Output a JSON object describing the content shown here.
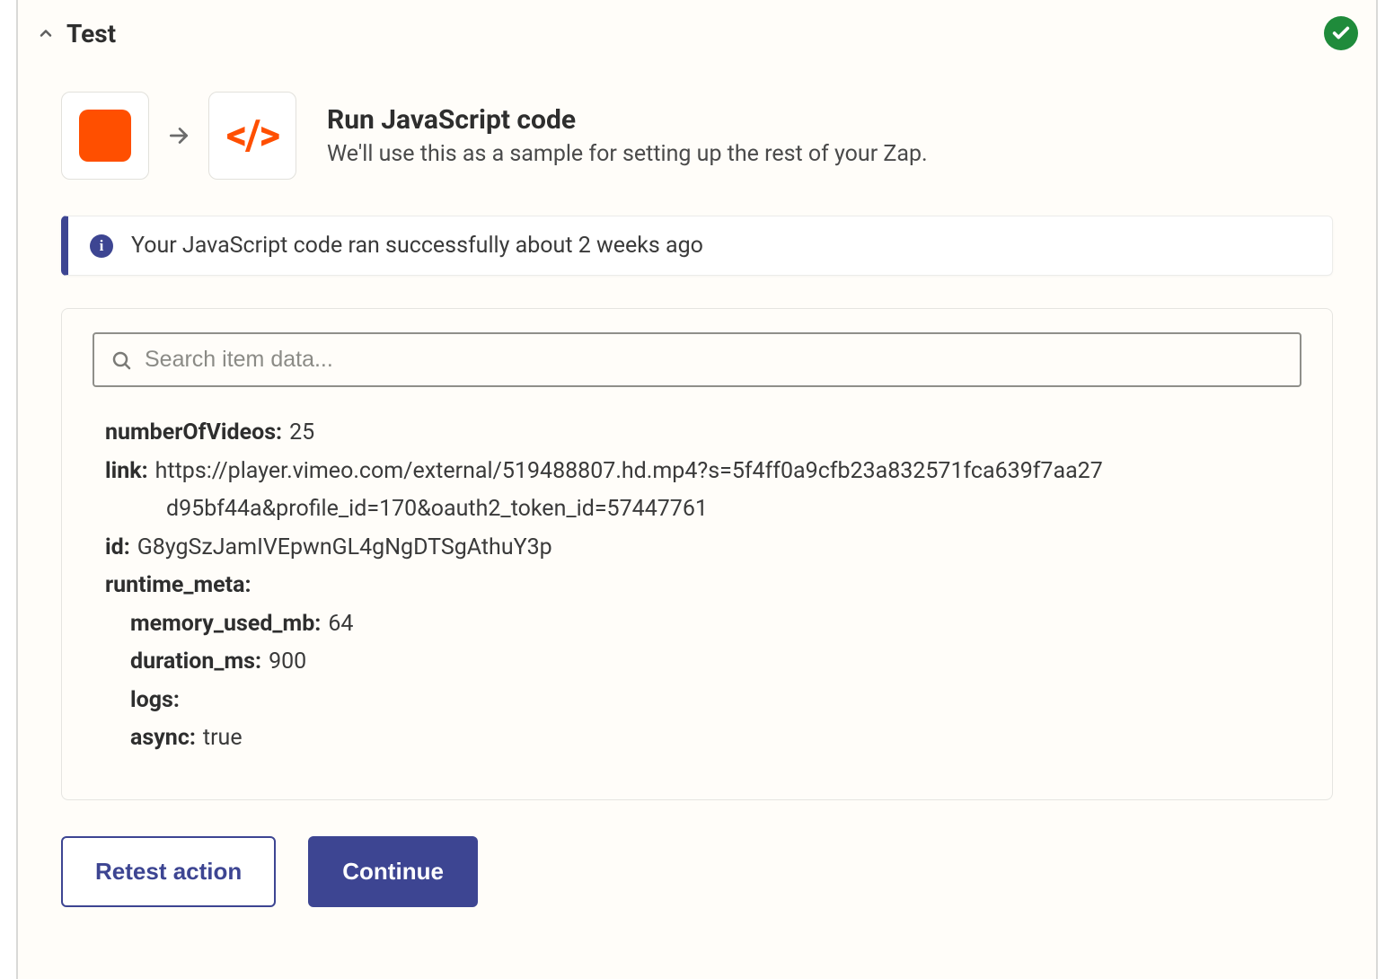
{
  "section": {
    "title": "Test",
    "status": "success"
  },
  "action": {
    "title": "Run JavaScript code",
    "subtitle": "We'll use this as a sample for setting up the rest of your Zap."
  },
  "info": {
    "message": "Your JavaScript code ran successfully about 2 weeks ago"
  },
  "search": {
    "placeholder": "Search item data..."
  },
  "result": {
    "numberOfVideos_label": "numberOfVideos:",
    "numberOfVideos": "25",
    "link_label": "link:",
    "link_line1": "https://player.vimeo.com/external/519488807.hd.mp4?s=5f4ff0a9cfb23a832571fca639f7aa27",
    "link_line2": "d95bf44a&profile_id=170&oauth2_token_id=57447761",
    "id_label": "id:",
    "id": "G8ygSzJamIVEpwnGL4gNgDTSgAthuY3p",
    "runtime_meta_label": "runtime_meta:",
    "memory_used_mb_label": "memory_used_mb:",
    "memory_used_mb": "64",
    "duration_ms_label": "duration_ms:",
    "duration_ms": "900",
    "logs_label": "logs:",
    "logs": "",
    "async_label": "async:",
    "async": "true"
  },
  "buttons": {
    "retest": "Retest action",
    "continue": "Continue"
  }
}
